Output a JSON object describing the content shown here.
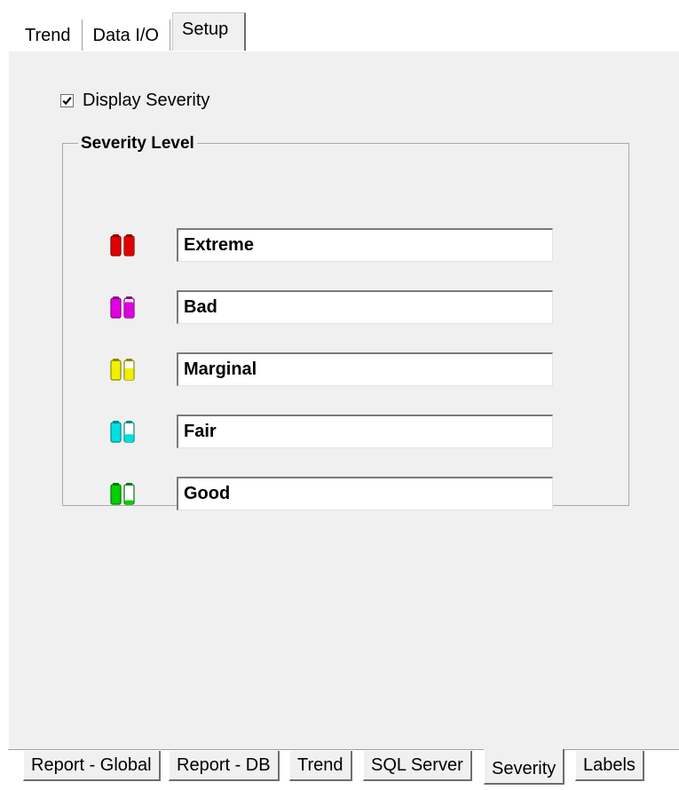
{
  "top_tabs": [
    {
      "label": "Trend",
      "active": false
    },
    {
      "label": "Data I/O",
      "active": false
    },
    {
      "label": "Setup",
      "active": true
    }
  ],
  "display_severity": {
    "label": "Display Severity",
    "checked": true
  },
  "severity_group": {
    "title": "Severity Level",
    "levels": [
      {
        "value": "Extreme",
        "icon": "severity-extreme-icon",
        "color": "#e00000",
        "dark": "#8a0000",
        "fill": 1.0
      },
      {
        "value": "Bad",
        "icon": "severity-bad-icon",
        "color": "#e000e0",
        "dark": "#8a008a",
        "fill": 0.8
      },
      {
        "value": "Marginal",
        "icon": "severity-marginal-icon",
        "color": "#f0f000",
        "dark": "#8a8a00",
        "fill": 0.6
      },
      {
        "value": "Fair",
        "icon": "severity-fair-icon",
        "color": "#00e0e0",
        "dark": "#008a8a",
        "fill": 0.4
      },
      {
        "value": "Good",
        "icon": "severity-good-icon",
        "color": "#00d000",
        "dark": "#007a00",
        "fill": 0.2
      }
    ]
  },
  "bottom_tabs": [
    {
      "label": "Report - Global",
      "active": false
    },
    {
      "label": "Report - DB",
      "active": false
    },
    {
      "label": "Trend",
      "active": false
    },
    {
      "label": "SQL Server",
      "active": false
    },
    {
      "label": "Severity",
      "active": true
    },
    {
      "label": "Labels",
      "active": false
    }
  ]
}
